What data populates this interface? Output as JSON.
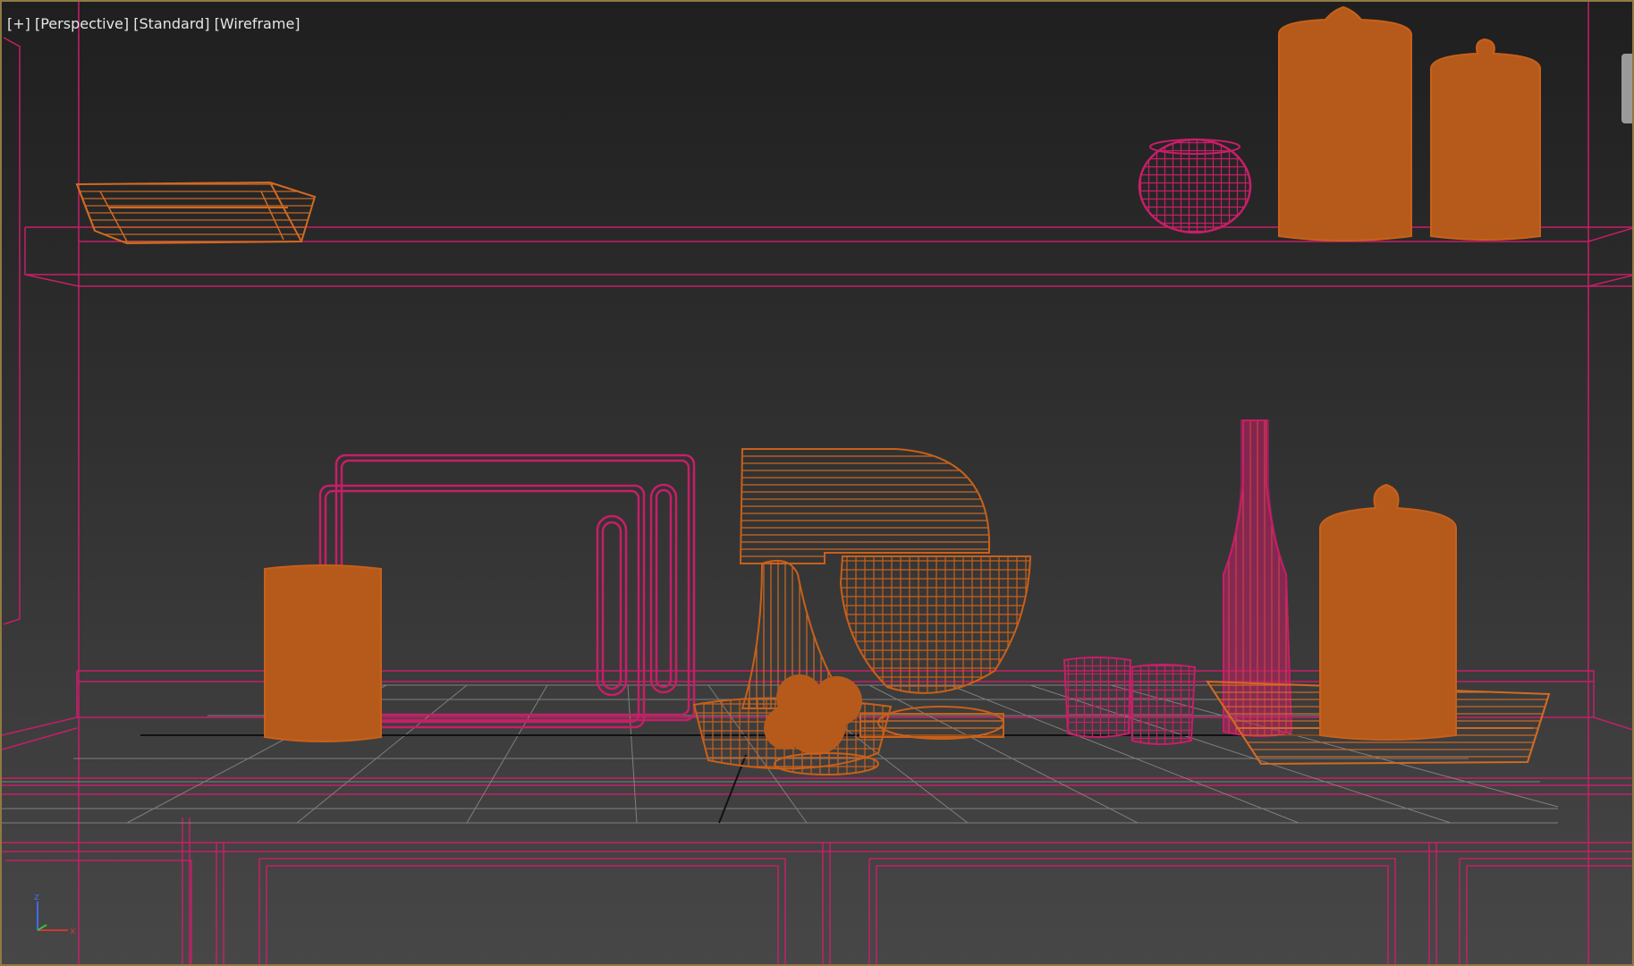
{
  "viewport": {
    "labels": [
      {
        "id": "plus",
        "text": "[+]"
      },
      {
        "id": "view",
        "text": "[Perspective]"
      },
      {
        "id": "shading",
        "text": "[Standard]"
      },
      {
        "id": "render",
        "text": "[Wireframe]"
      }
    ],
    "gizmo": {
      "z": "z",
      "x": "x",
      "y": "y"
    }
  },
  "colors": {
    "background_top": "#1f1f1f",
    "background_bottom": "#474747",
    "selected_wire": "#c8601a",
    "shaded_orange": "#b65a1b",
    "frozen_magenta": "#c71e68",
    "grid": "#8a8a8a",
    "frame": "#8e7a44"
  },
  "icons": {
    "axis_gizmo": "axis-gizmo-icon",
    "viewport_tab": "viewport-tab"
  }
}
